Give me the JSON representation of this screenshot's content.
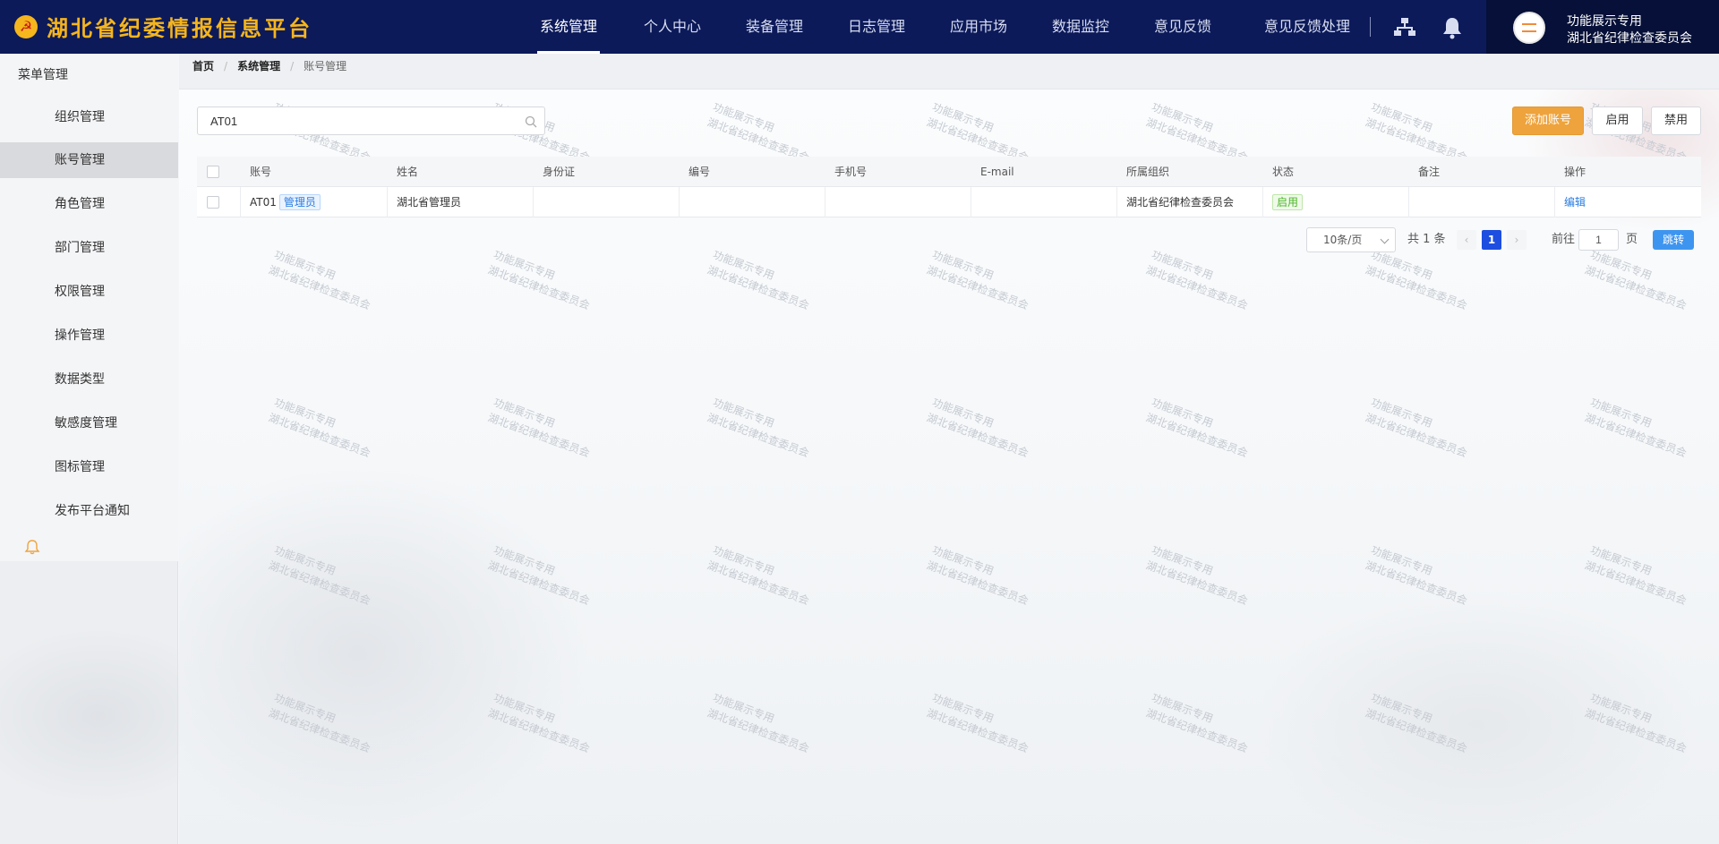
{
  "app": {
    "title": "湖北省纪委情报信息平台",
    "emblem": "☭"
  },
  "topnav": {
    "items": [
      {
        "label": "系统管理",
        "active": true
      },
      {
        "label": "个人中心",
        "active": false
      },
      {
        "label": "装备管理",
        "active": false
      },
      {
        "label": "日志管理",
        "active": false
      },
      {
        "label": "应用市场",
        "active": false
      },
      {
        "label": "数据监控",
        "active": false
      },
      {
        "label": "意见反馈",
        "active": false
      },
      {
        "label": "意见反馈处理",
        "active": false
      }
    ],
    "icons": [
      "sitemap-icon",
      "bell-icon"
    ]
  },
  "user": {
    "line1": "功能展示专用",
    "line2": "湖北省纪律检查委员会"
  },
  "sidebar": {
    "title": "菜单管理",
    "items": [
      {
        "label": "组织管理",
        "active": false
      },
      {
        "label": "账号管理",
        "active": true
      },
      {
        "label": "角色管理",
        "active": false
      },
      {
        "label": "部门管理",
        "active": false
      },
      {
        "label": "权限管理",
        "active": false
      },
      {
        "label": "操作管理",
        "active": false
      },
      {
        "label": "数据类型",
        "active": false
      },
      {
        "label": "敏感度管理",
        "active": false
      },
      {
        "label": "图标管理",
        "active": false
      },
      {
        "label": "发布平台通知",
        "active": false
      }
    ]
  },
  "breadcrumb": [
    "首页",
    "系统管理",
    "账号管理"
  ],
  "search": {
    "value": "AT01",
    "placeholder": ""
  },
  "actions": {
    "add": "添加账号",
    "enable": "启用",
    "disable": "禁用"
  },
  "table": {
    "columns": [
      "账号",
      "姓名",
      "身份证",
      "编号",
      "手机号",
      "E-mail",
      "所属组织",
      "状态",
      "备注",
      "操作"
    ],
    "rows": [
      {
        "account": "AT01",
        "role": "管理员",
        "name": "湖北省管理员",
        "id_card": "",
        "number": "",
        "phone": "",
        "email": "",
        "org": "湖北省纪律检查委员会",
        "status": "启用",
        "note": "",
        "op": "编辑"
      }
    ]
  },
  "pagination": {
    "page_size": "10条/页",
    "total": "共 1 条",
    "current": "1",
    "goto_label": "前往",
    "goto_value": "1",
    "goto_unit": "页",
    "jump": "跳转",
    "prev": "‹",
    "next": "›"
  },
  "watermark": {
    "line1": "功能展示专用",
    "line2": "湖北省纪律检查委员会"
  },
  "colors": {
    "header_bg": "#0c1a5a",
    "brand_gold": "#f5b51d",
    "primary": "#1d4ee0",
    "add_button": "#eea33c",
    "status_green": "#4bb526"
  }
}
